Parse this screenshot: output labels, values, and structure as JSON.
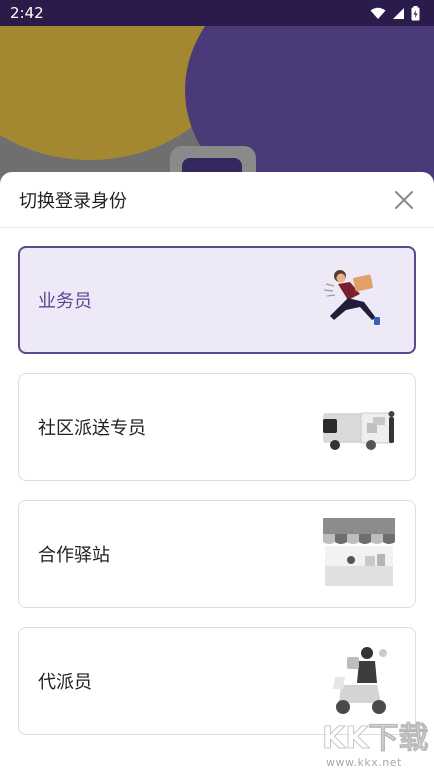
{
  "status_bar": {
    "time": "2:42",
    "icons": [
      "wifi-icon",
      "signal-icon",
      "battery-icon"
    ]
  },
  "sheet": {
    "title": "切换登录身份",
    "close_icon": "close-icon"
  },
  "roles": [
    {
      "label": "业务员",
      "selected": true,
      "illustration": "running-courier-illustration"
    },
    {
      "label": "社区派送专员",
      "selected": false,
      "illustration": "delivery-van-illustration"
    },
    {
      "label": "合作驿站",
      "selected": false,
      "illustration": "station-storefront-illustration"
    },
    {
      "label": "代派员",
      "selected": false,
      "illustration": "scooter-courier-illustration"
    }
  ],
  "watermark": {
    "logo_text": "KK下载",
    "url": "www.kkx.net"
  },
  "colors": {
    "accent": "#5a4891",
    "selected_bg": "#ede9f6",
    "status_bar_bg": "#2a1b4a"
  }
}
